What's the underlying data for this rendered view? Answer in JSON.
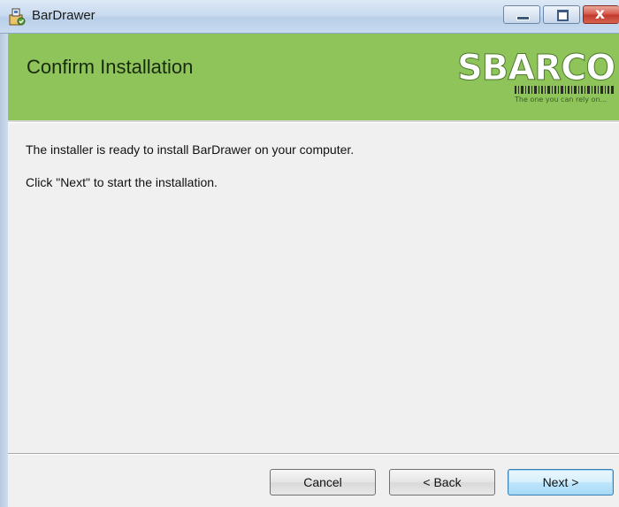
{
  "window": {
    "title": "BarDrawer",
    "app_icon": "installer-icon",
    "controls": {
      "minimize_icon": "minimize-icon",
      "maximize_icon": "maximize-icon",
      "close_icon": "close-icon",
      "close_glyph": "x"
    }
  },
  "banner": {
    "title": "Confirm Installation",
    "background_color": "#8ec45a",
    "logo": {
      "name": "SBARCO",
      "tagline": "The one you can rely on..."
    }
  },
  "content": {
    "line1": "The installer is ready to install BarDrawer on your computer.",
    "line2": "Click \"Next\" to start the installation."
  },
  "buttons": {
    "cancel": "Cancel",
    "back": "< Back",
    "next": "Next >"
  }
}
